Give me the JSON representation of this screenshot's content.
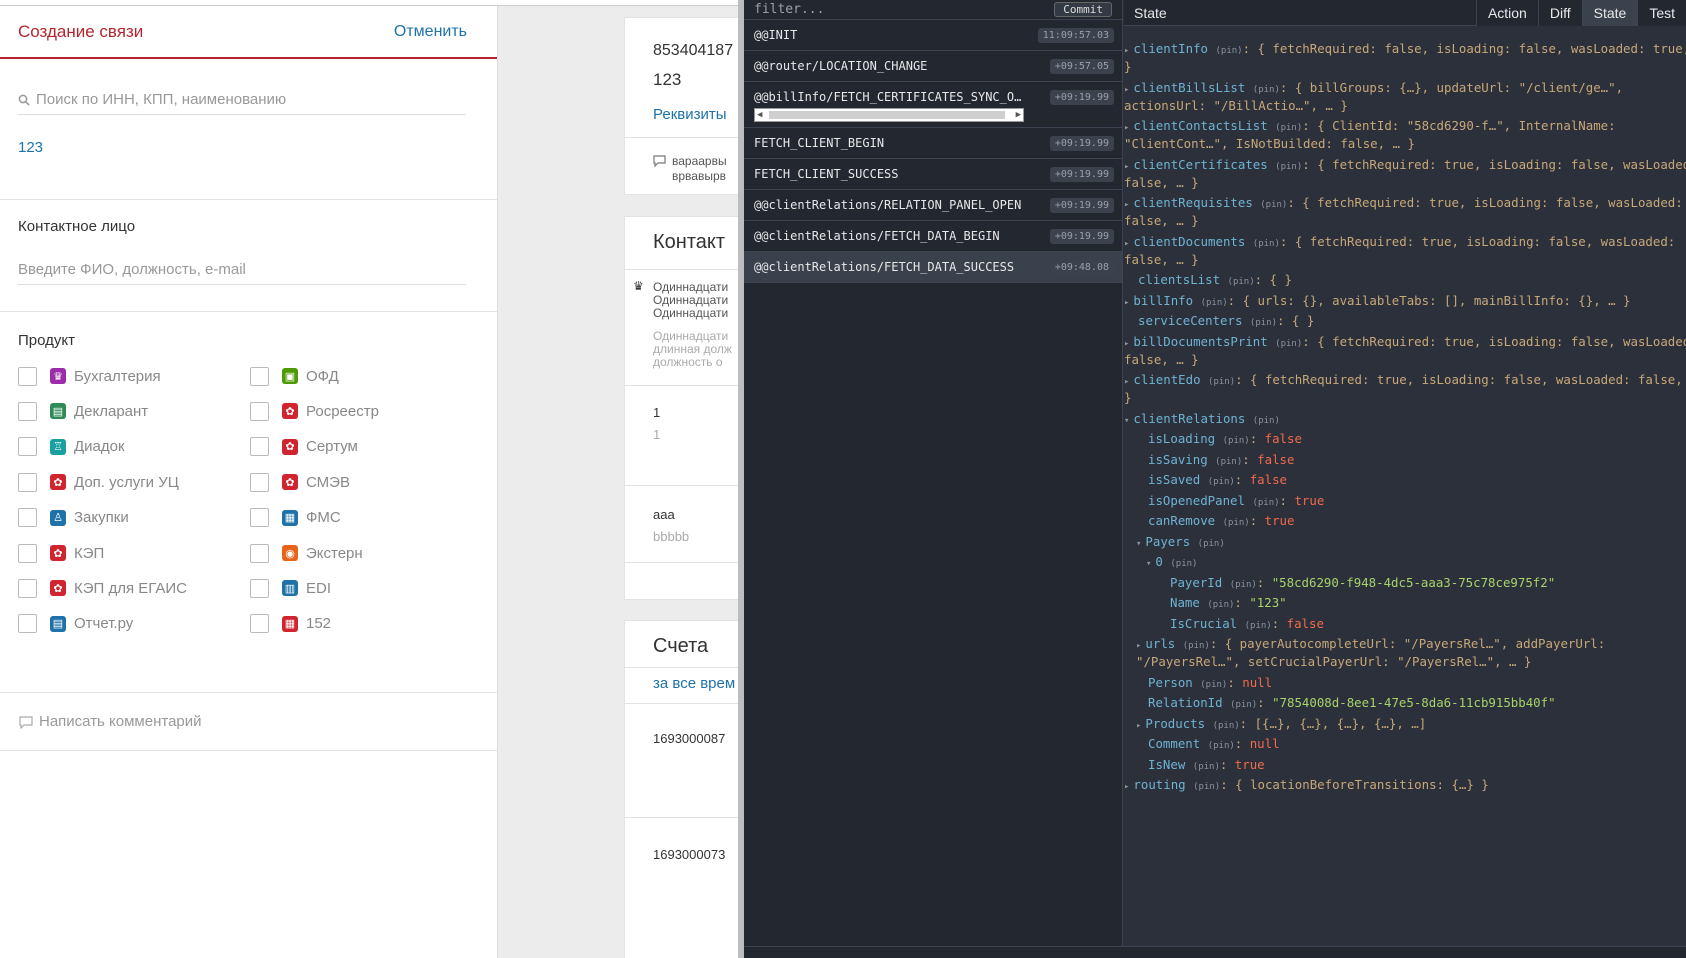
{
  "left": {
    "title": "Создание связи",
    "cancel": "Отменить",
    "search_placeholder": "Поиск по ИНН, КПП, наименованию",
    "search_value": "123",
    "contact_title": "Контактное лицо",
    "contact_placeholder": "Введите ФИО, должность, e-mail",
    "product_title": "Продукт",
    "products": [
      {
        "label": "Бухгалтерия",
        "color": "#9b2da8",
        "glyph": "♛"
      },
      {
        "label": "ОФД",
        "color": "#4e9a06",
        "glyph": "▣"
      },
      {
        "label": "Декларант",
        "color": "#2e8b57",
        "glyph": "▤"
      },
      {
        "label": "Росреестр",
        "color": "#d0242e",
        "glyph": "✿"
      },
      {
        "label": "Диадок",
        "color": "#1aa0a0",
        "glyph": "♖"
      },
      {
        "label": "Сертум",
        "color": "#d0242e",
        "glyph": "✿"
      },
      {
        "label": "Доп. услуги УЦ",
        "color": "#d0242e",
        "glyph": "✿"
      },
      {
        "label": "СМЭВ",
        "color": "#d0242e",
        "glyph": "✿"
      },
      {
        "label": "Закупки",
        "color": "#1f72a7",
        "glyph": "♙"
      },
      {
        "label": "ФМС",
        "color": "#1f72a7",
        "glyph": "▦"
      },
      {
        "label": "КЭП",
        "color": "#d0242e",
        "glyph": "✿"
      },
      {
        "label": "Экстерн",
        "color": "#e8641b",
        "glyph": "◉"
      },
      {
        "label": "КЭП для ЕГАИС",
        "color": "#d0242e",
        "glyph": "✿"
      },
      {
        "label": "EDI",
        "color": "#1f72a7",
        "glyph": "▥"
      },
      {
        "label": "Отчет.ру",
        "color": "#1f72a7",
        "glyph": "▤"
      },
      {
        "label": "152",
        "color": "#d0242e",
        "glyph": "▦"
      }
    ],
    "comment": "Написать комментарий"
  },
  "middle": {
    "inn": "853404187",
    "kpp": "123",
    "requisites": "Реквизиты",
    "note1": "вараарвы",
    "note2": "врвавырв",
    "contacts_title": "Контакт",
    "c1": "Одиннадцати",
    "c2": "Одиннадцати",
    "c3": "Одиннадцати",
    "c4": "Одиннадцати",
    "c5": "длинная долж",
    "c6": "должность о",
    "one_a": "1",
    "one_b": "1",
    "aaa": "aaa",
    "bbbbb": "bbbbb",
    "bills_title": "Счета",
    "bills_period": "за все врем",
    "bill1": "1693000087",
    "bill2": "1693000073"
  },
  "devtools": {
    "filter_placeholder": "filter...",
    "commit": "Commit",
    "actions": [
      {
        "name": "@@INIT",
        "time": "11:09:57.03"
      },
      {
        "name": "@@router/LOCATION_CHANGE",
        "time": "+09:57.05"
      },
      {
        "name": "@@billInfo/FETCH_CERTIFICATES_SYNC_O…",
        "time": "+09:19.99"
      },
      {
        "name": "FETCH_CLIENT_BEGIN",
        "time": "+09:19.99"
      },
      {
        "name": "FETCH_CLIENT_SUCCESS",
        "time": "+09:19.99"
      },
      {
        "name": "@@clientRelations/RELATION_PANEL_OPEN",
        "time": "+09:19.99"
      },
      {
        "name": "@@clientRelations/FETCH_DATA_BEGIN",
        "time": "+09:19.99"
      },
      {
        "name": "@@clientRelations/FETCH_DATA_SUCCESS",
        "time": "+09:48.08"
      }
    ],
    "state_title": "State",
    "tabs": [
      "Action",
      "Diff",
      "State",
      "Test"
    ],
    "pin": "(pin)",
    "tree": {
      "clientInfo": [
        "clientInfo",
        "{ fetchRequired: false, isLoading: false, wasLoaded: true, …",
        "}"
      ],
      "clientBillsList": [
        "clientBillsList",
        "{ billGroups: {…}, updateUrl: \"/client/ge…\",",
        "actionsUrl: \"/BillActio…\", … }"
      ],
      "clientContactsList": [
        "clientContactsList",
        "{ ClientId: \"58cd6290-f…\", InternalName:",
        "\"ClientCont…\", IsNotBuilded: false, … }"
      ],
      "clientCertificates": [
        "clientCertificates",
        "{ fetchRequired: true, isLoading: false, wasLoaded:",
        "false, … }"
      ],
      "clientRequisites": [
        "clientRequisites",
        "{ fetchRequired: true, isLoading: false, wasLoaded:",
        "false, … }"
      ],
      "clientDocuments": [
        "clientDocuments",
        "{ fetchRequired: true, isLoading: false, wasLoaded:",
        "false, … }"
      ],
      "clientsList": [
        "clientsList",
        "{ }"
      ],
      "billInfo": [
        "billInfo",
        "{ urls: {}, availableTabs: [], mainBillInfo: {}, … }"
      ],
      "serviceCenters": [
        "serviceCenters",
        "{ }"
      ],
      "billDocumentsPrint": [
        "billDocumentsPrint",
        "{ fetchRequired: true, isLoading: false, wasLoaded:",
        "false, … }"
      ],
      "clientEdo": [
        "clientEdo",
        "{ fetchRequired: true, isLoading: false, wasLoaded: false, …",
        "}"
      ],
      "clientRelations": "clientRelations",
      "isLoading": [
        "isLoading",
        "false"
      ],
      "isSaving": [
        "isSaving",
        "false"
      ],
      "isSaved": [
        "isSaved",
        "false"
      ],
      "isOpenedPanel": [
        "isOpenedPanel",
        "true"
      ],
      "canRemove": [
        "canRemove",
        "true"
      ],
      "Payers": "Payers",
      "zero": "0",
      "PayerId": [
        "PayerId",
        "\"58cd6290-f948-4dc5-aaa3-75c78ce975f2\""
      ],
      "Name": [
        "Name",
        "\"123\""
      ],
      "IsCrucial": [
        "IsCrucial",
        "false"
      ],
      "urls": [
        "urls",
        "{ payerAutocompleteUrl: \"/PayersRel…\", addPayerUrl:",
        "\"/PayersRel…\", setCrucialPayerUrl: \"/PayersRel…\", … }"
      ],
      "Person": [
        "Person",
        "null"
      ],
      "RelationId": [
        "RelationId",
        "\"7854008d-8ee1-47e5-8da6-11cb915bb40f\""
      ],
      "Products": [
        "Products",
        "[{…}, {…}, {…}, {…}, …]"
      ],
      "Comment": [
        "Comment",
        "null"
      ],
      "IsNew": [
        "IsNew",
        "true"
      ],
      "routing": [
        "routing",
        "{ locationBeforeTransitions: {…} }"
      ]
    }
  },
  "colors": {
    "brand_red": "#b5242f",
    "link_blue": "#1f72a7",
    "devtools_bg": "#2b303b"
  }
}
